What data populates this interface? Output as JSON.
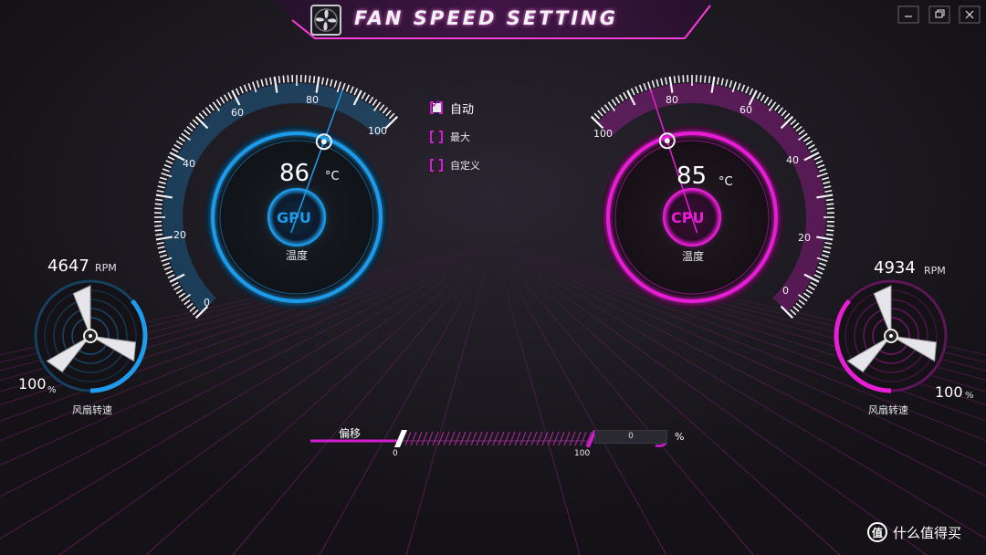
{
  "window": {
    "title": "FAN SPEED SETTING",
    "controls": [
      "minimize",
      "restore",
      "close"
    ]
  },
  "colors": {
    "gpu_accent": "#1e9bea",
    "cpu_accent": "#e81ed6",
    "magenta": "#d21dd0",
    "background": "#17151a"
  },
  "gpu": {
    "chip_label": "GPU",
    "temperature": "86",
    "temp_unit": "°C",
    "temp_caption": "温度",
    "gauge_scale": [
      "0",
      "20",
      "40",
      "60",
      "80",
      "100"
    ],
    "fan_rpm": "4647",
    "rpm_unit": "RPM",
    "fan_percent": "100",
    "percent_unit": "%",
    "fan_caption": "风扇转速",
    "fan_level": 1.0
  },
  "cpu": {
    "chip_label": "CPU",
    "temperature": "85",
    "temp_unit": "°C",
    "temp_caption": "温度",
    "gauge_scale": [
      "0",
      "20",
      "40",
      "60",
      "80",
      "100"
    ],
    "fan_rpm": "4934",
    "rpm_unit": "RPM",
    "fan_percent": "100",
    "percent_unit": "%",
    "fan_caption": "风扇转速",
    "fan_level": 1.0
  },
  "mode": {
    "options": [
      {
        "label": "自动",
        "checked": true
      },
      {
        "label": "最大",
        "checked": false
      },
      {
        "label": "自定义",
        "checked": false
      }
    ]
  },
  "offset": {
    "label": "偏移",
    "min_label": "0",
    "max_label": "100",
    "value": "0",
    "unit": "%"
  },
  "watermark": {
    "icon": "值",
    "text": "什么值得买"
  }
}
